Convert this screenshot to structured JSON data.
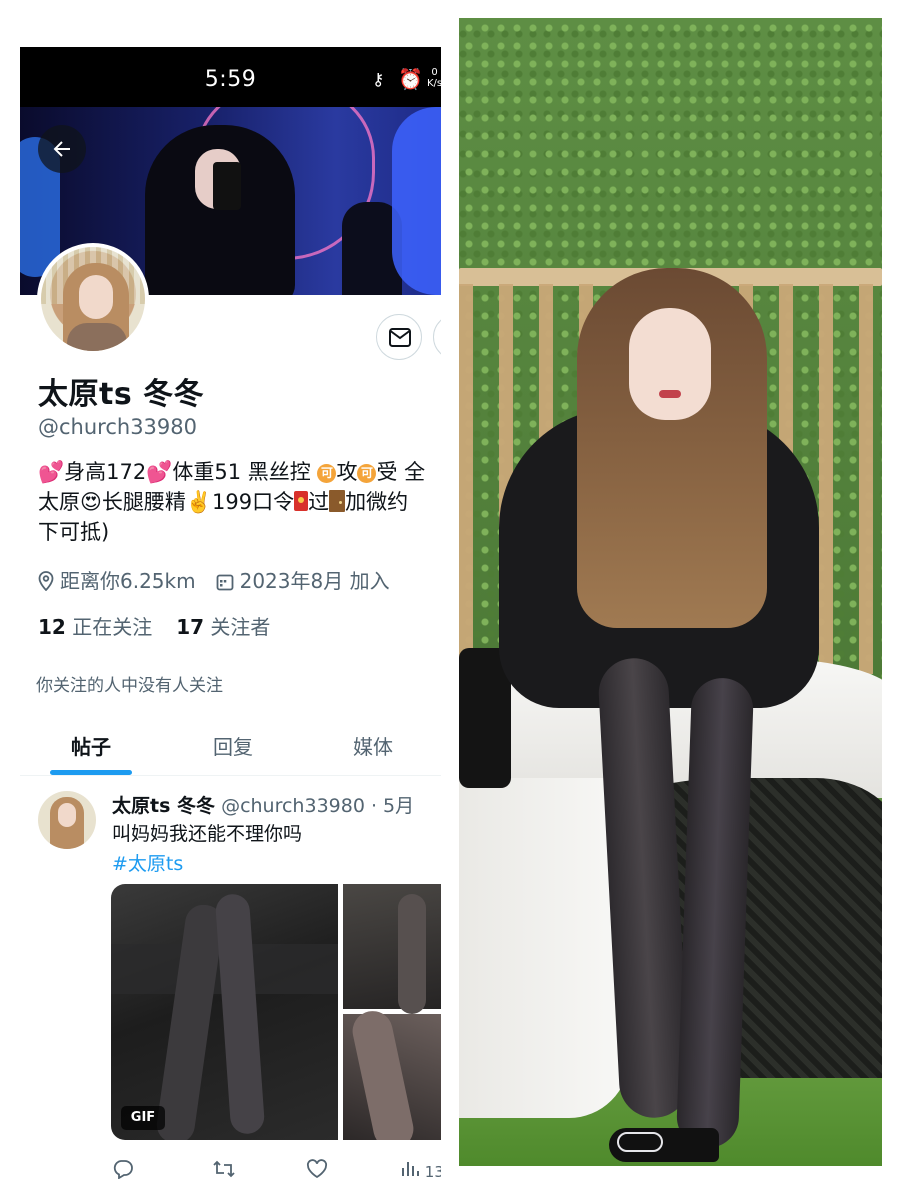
{
  "status_bar": {
    "time": "5:59",
    "icons": [
      "key-icon",
      "alarm-icon"
    ],
    "net_speed_value": "0",
    "net_speed_unit": "K/s"
  },
  "profile": {
    "display_name": "太原ts 冬冬",
    "handle": "@church33980",
    "bio": {
      "line1_a": "💕身高172💕体重51 黑丝控 ",
      "badge_ke": "可",
      "line1_b": "攻",
      "line1_c": "受 全",
      "line2_a": "太原😍长腿腰精✌️199口令",
      "line2_b": "过",
      "line2_c": "加微约",
      "line3": "下可抵)"
    },
    "location": "距离你6.25km",
    "joined": "2023年8月 加入",
    "following_count": "12",
    "following_label": "正在关注",
    "followers_count": "17",
    "followers_label": "关注者",
    "followers_note": "你关注的人中没有人关注"
  },
  "tabs": {
    "posts": "帖子",
    "replies": "回复",
    "media": "媒体"
  },
  "post": {
    "author_name": "太原ts 冬冬",
    "author_handle": "@church33980",
    "separator": " · ",
    "date": "5月",
    "text": "叫妈妈我还能不理你吗",
    "hashtag": "#太原ts",
    "gif_label": "GIF",
    "views_count": "13"
  },
  "colors": {
    "accent": "#1d9bf0",
    "muted_text": "#536471",
    "primary_text": "#0f1419",
    "status_bar_bg": "#000000",
    "badge_orange": "#f4a43a"
  }
}
